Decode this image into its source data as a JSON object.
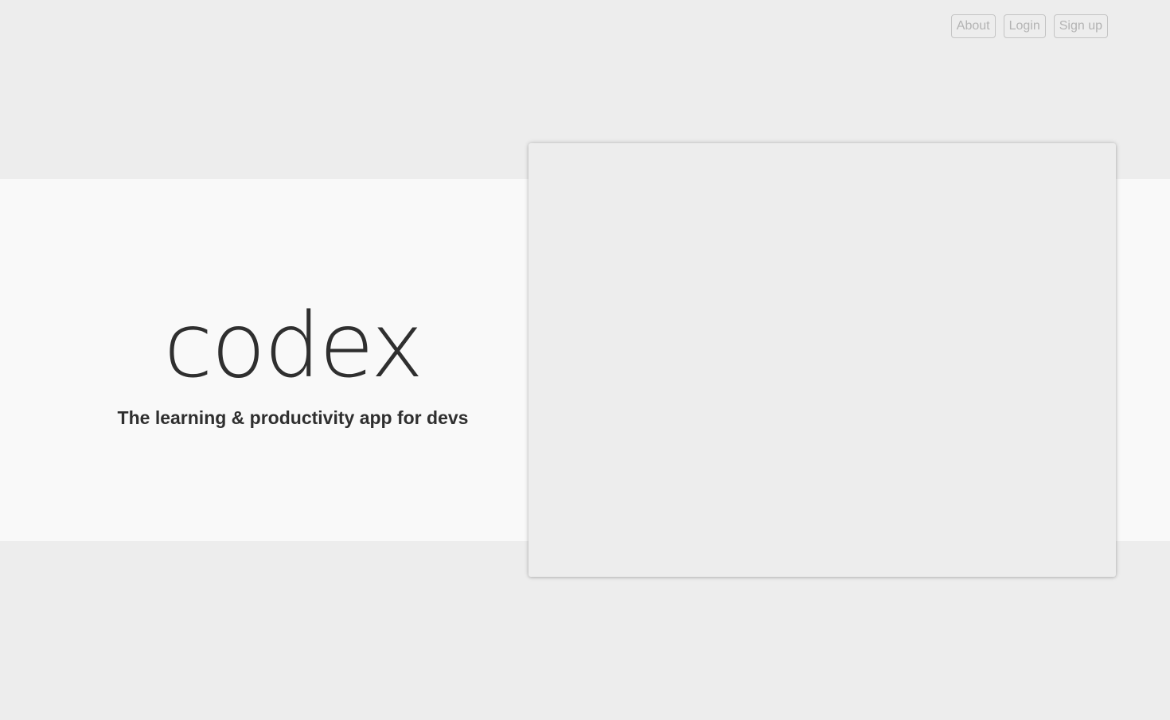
{
  "nav": {
    "about_label": "About",
    "login_label": "Login",
    "signup_label": "Sign up"
  },
  "hero": {
    "logo_text": "codex",
    "tagline": "The learning & productivity app for devs"
  },
  "colors": {
    "page_background": "#ededed",
    "band_background": "#f9f9f9",
    "text_primary": "#2f2f2f",
    "nav_text": "#b3b3b3",
    "nav_border": "#c4c4c4"
  }
}
